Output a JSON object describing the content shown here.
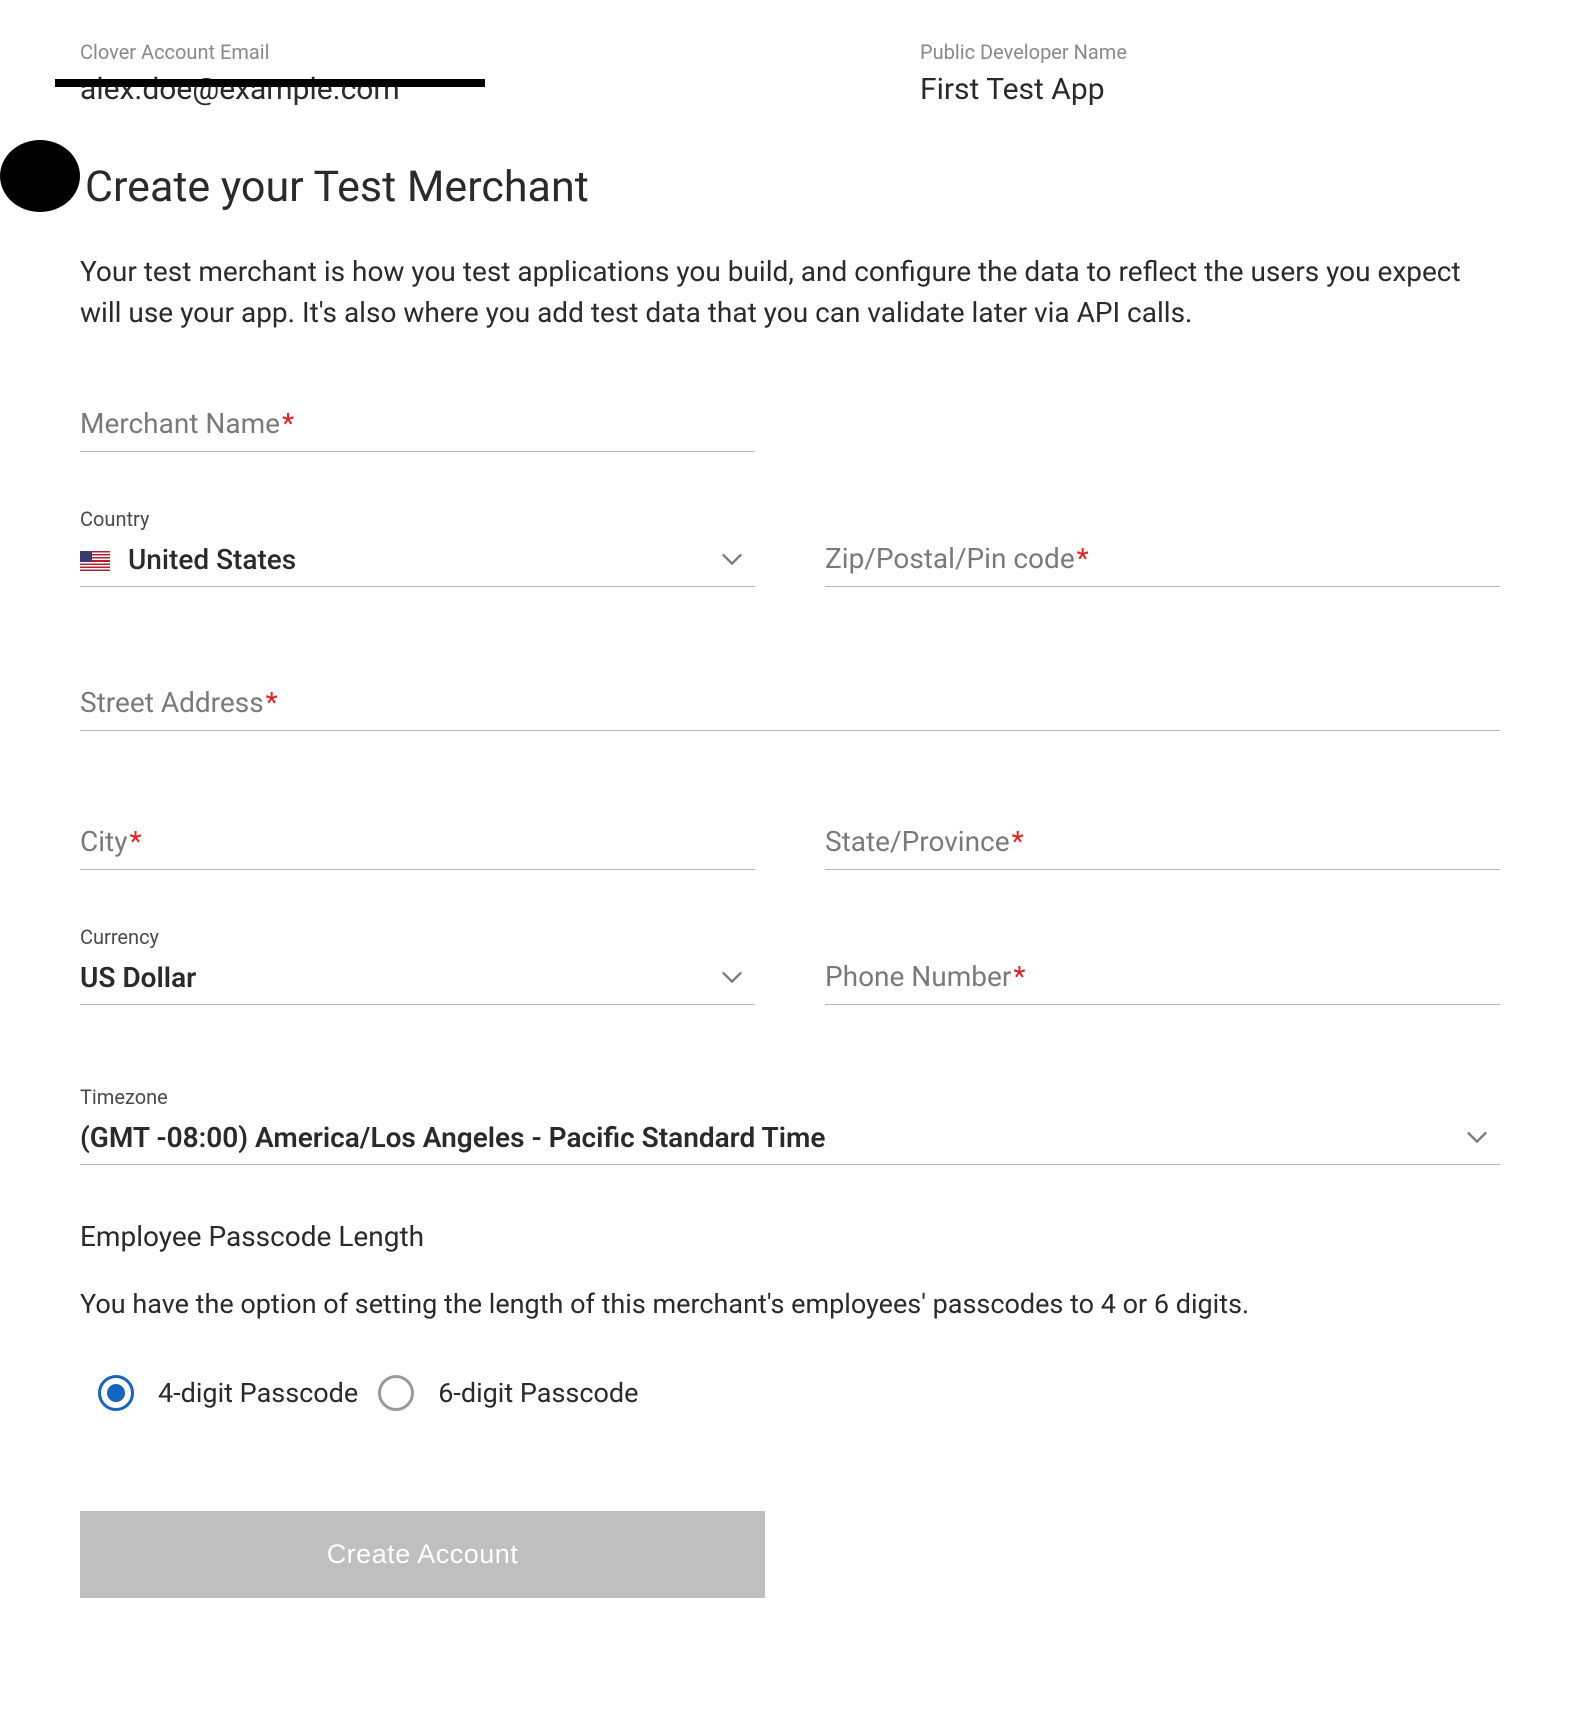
{
  "header": {
    "email_label": "Clover Account Email",
    "email_value": "alex.doe@example.com",
    "devname_label": "Public Developer Name",
    "devname_value": "First Test App"
  },
  "page": {
    "title": "Create your Test Merchant",
    "description": "Your test merchant is how you test applications you build, and configure the data to reflect the users you expect will use your app. It's also where you add test data that you can validate later via API calls."
  },
  "form": {
    "merchant_name": {
      "label": "Merchant Name"
    },
    "country": {
      "label": "Country",
      "value": "United States"
    },
    "zip": {
      "label": "Zip/Postal/Pin code"
    },
    "street": {
      "label": "Street Address"
    },
    "city": {
      "label": "City"
    },
    "state": {
      "label": "State/Province"
    },
    "currency": {
      "label": "Currency",
      "value": "US Dollar"
    },
    "phone": {
      "label": "Phone Number"
    },
    "timezone": {
      "label": "Timezone",
      "value": "(GMT -08:00) America/Los Angeles - Pacific Standard Time"
    }
  },
  "passcode": {
    "title": "Employee Passcode Length",
    "description": "You have the option of setting the length of this merchant's employees' passcodes to 4 or 6 digits.",
    "option1": "4-digit Passcode",
    "option2": "6-digit Passcode"
  },
  "submit": {
    "label": "Create Account"
  }
}
